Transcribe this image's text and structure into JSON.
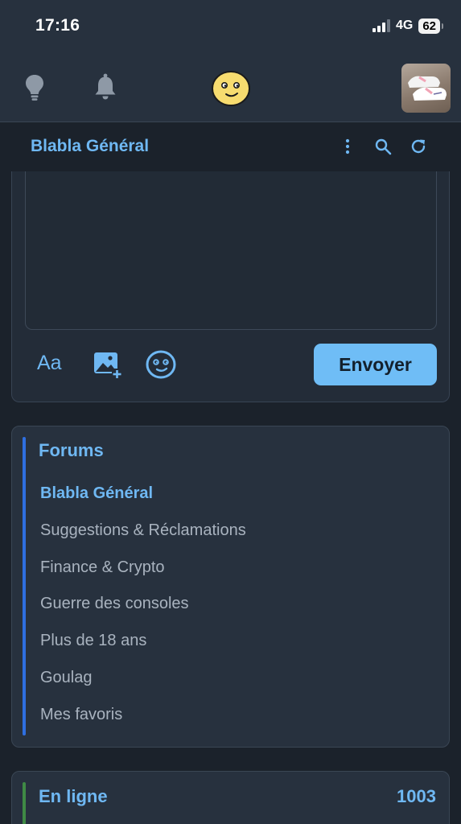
{
  "status_bar": {
    "time": "17:16",
    "network": "4G",
    "battery": "62"
  },
  "header": {
    "icons": [
      "lightbulb-icon",
      "bell-icon",
      "smiley-logo-icon"
    ],
    "avatar": "user-avatar-sneakers"
  },
  "forum_bar": {
    "title": "Blabla Général",
    "icons": [
      "more-vertical-icon",
      "search-icon",
      "refresh-icon"
    ]
  },
  "composer": {
    "message_value": "",
    "format_label": "Aa",
    "tools": [
      "text-format",
      "add-image-icon",
      "emoji-icon"
    ],
    "send_label": "Envoyer"
  },
  "forums": {
    "heading": "Forums",
    "items": [
      {
        "label": "Blabla Général",
        "active": true
      },
      {
        "label": "Suggestions & Réclamations",
        "active": false
      },
      {
        "label": "Finance & Crypto",
        "active": false
      },
      {
        "label": "Guerre des consoles",
        "active": false
      },
      {
        "label": "Plus de 18 ans",
        "active": false
      },
      {
        "label": "Goulag",
        "active": false
      },
      {
        "label": "Mes favoris",
        "active": false
      }
    ]
  },
  "online": {
    "heading": "En ligne",
    "count": "1003"
  },
  "colors": {
    "accent": "#6fb8f3",
    "button": "#6fbdf6",
    "background": "#1b222b",
    "card": "#27313e",
    "forums_accent_bar": "#2f6fe0",
    "online_accent_bar": "#3f8a45"
  }
}
